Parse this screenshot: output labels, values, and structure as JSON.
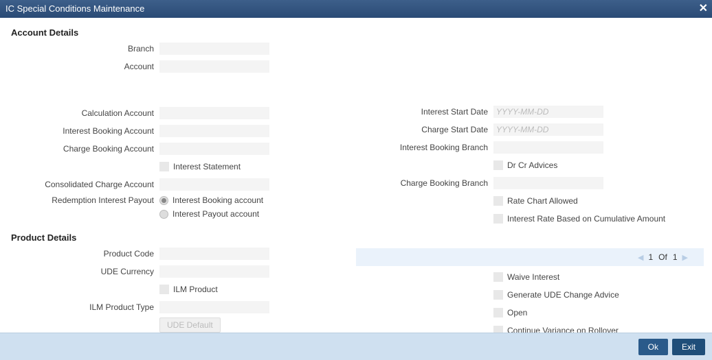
{
  "titlebar": {
    "title": "IC Special Conditions Maintenance"
  },
  "sections": {
    "account_details": "Account Details",
    "product_details": "Product Details"
  },
  "left": {
    "branch": {
      "label": "Branch",
      "value": ""
    },
    "account": {
      "label": "Account",
      "value": ""
    },
    "calc_account": {
      "label": "Calculation Account",
      "value": ""
    },
    "int_book_account": {
      "label": "Interest Booking Account",
      "value": ""
    },
    "chg_book_account": {
      "label": "Charge Booking Account",
      "value": ""
    },
    "interest_statement": {
      "label": "Interest Statement"
    },
    "cons_charge_account": {
      "label": "Consolidated Charge Account",
      "value": ""
    },
    "redemption_payout": {
      "label": "Redemption Interest Payout",
      "options": [
        "Interest Booking account",
        "Interest Payout account"
      ],
      "selected": 0
    },
    "product_code": {
      "label": "Product Code",
      "value": ""
    },
    "ude_currency": {
      "label": "UDE Currency",
      "value": ""
    },
    "ilm_product": {
      "label": "ILM Product"
    },
    "ilm_product_type": {
      "label": "ILM Product Type",
      "value": ""
    },
    "ude_default_btn": "UDE Default"
  },
  "right": {
    "interest_start": {
      "label": "Interest Start Date",
      "placeholder": "YYYY-MM-DD",
      "value": ""
    },
    "charge_start": {
      "label": "Charge Start Date",
      "placeholder": "YYYY-MM-DD",
      "value": ""
    },
    "int_book_branch": {
      "label": "Interest Booking Branch",
      "value": ""
    },
    "dr_cr_advices": {
      "label": "Dr Cr Advices"
    },
    "chg_book_branch": {
      "label": "Charge Booking Branch",
      "value": ""
    },
    "rate_chart": {
      "label": "Rate Chart Allowed"
    },
    "rate_cumulative": {
      "label": "Interest Rate Based on Cumulative Amount"
    },
    "waive_interest": {
      "label": "Waive Interest"
    },
    "gen_ude_advice": {
      "label": "Generate UDE Change Advice"
    },
    "open": {
      "label": "Open"
    },
    "cont_variance": {
      "label": "Continue Variance on Rollover"
    }
  },
  "pager": {
    "current": "1",
    "of": "Of",
    "total": "1"
  },
  "footer": {
    "ok": "Ok",
    "exit": "Exit"
  }
}
